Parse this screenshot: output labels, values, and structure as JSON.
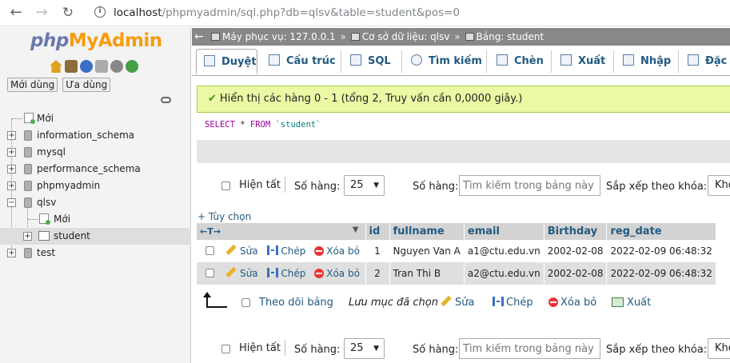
{
  "browser": {
    "url_host": "localhost",
    "url_path": "/phpmyadmin/sql.php?db=qlsv&table=student&pos=0"
  },
  "leftnav": {
    "logo_php": "php",
    "logo_my": "MyAdmin",
    "tab_recent": "Mới dùng",
    "tab_favorite": "Ưa dùng",
    "tree": {
      "new": "Mới",
      "information_schema": "information_schema",
      "mysql": "mysql",
      "performance_schema": "performance_schema",
      "phpmyadmin": "phpmyadmin",
      "qlsv": "qlsv",
      "qlsv_new": "Mới",
      "student": "student",
      "test": "test"
    }
  },
  "breadcrumb": {
    "server": "Máy phục vụ: 127.0.0.1",
    "database": "Cơ sở dữ liệu: qlsv",
    "table": "Bảng: student"
  },
  "topmenu": {
    "browse": "Duyệt",
    "structure": "Cấu trúc",
    "sql": "SQL",
    "search": "Tìm kiếm",
    "insert": "Chèn",
    "export": "Xuất",
    "import": "Nhập",
    "more": "Đặc"
  },
  "message": {
    "success": "Hiển thị các hàng 0 - 1 (tổng 2, Truy vấn cần 0,0000 giây.)",
    "sql_select": "SELECT",
    "sql_star": " * ",
    "sql_from": "FROM",
    "sql_table": " `student`"
  },
  "navigation": {
    "show_all": "Hiện tất",
    "rows_label": "Số hàng:",
    "rows_value": "25",
    "filter_label": "Số hàng:",
    "filter_placeholder": "Tìm kiếm trong bảng này",
    "sort_label": "Sắp xếp theo khóa:",
    "sort_value": "Khô"
  },
  "options_link": "+ Tùy chọn",
  "table": {
    "columns": [
      "id",
      "fullname",
      "email",
      "Birthday",
      "reg_date"
    ],
    "actions": {
      "edit": "Sửa",
      "copy": "Chép",
      "delete": "Xóa bỏ"
    },
    "rows": [
      {
        "id": "1",
        "fullname": "Nguyen Van A",
        "email": "a1@ctu.edu.vn",
        "birthday": "2002-02-08",
        "reg_date": "2022-02-09 06:48:32"
      },
      {
        "id": "2",
        "fullname": "Tran Thi B",
        "email": "a2@ctu.edu.vn",
        "birthday": "2002-02-08",
        "reg_date": "2022-02-09 06:48:32"
      }
    ]
  },
  "bulk": {
    "check_all": "Theo dõi bảng",
    "with_selected": "Lưu mục đã chọn",
    "edit": "Sửa",
    "copy": "Chép",
    "delete": "Xóa bỏ",
    "export": "Xuất"
  }
}
